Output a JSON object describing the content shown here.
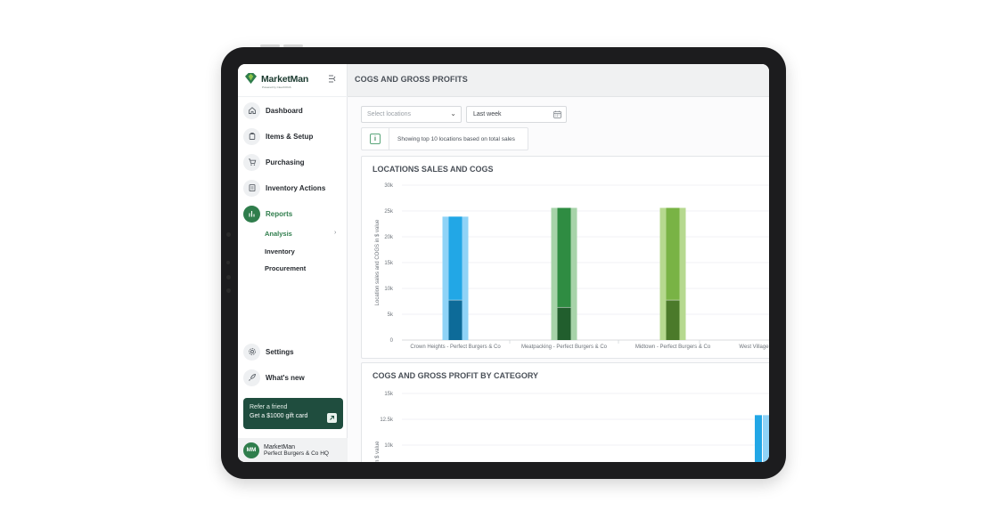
{
  "app": {
    "logo_text": "MarketMan",
    "logo_subtext": "Powered by ClearCOGS",
    "page_title": "COGS AND GROSS PROFITS"
  },
  "sidebar": {
    "collapse_icon": "collapse-icon",
    "items": [
      {
        "label": "Dashboard",
        "icon": "home-icon"
      },
      {
        "label": "Items & Setup",
        "icon": "items-icon"
      },
      {
        "label": "Purchasing",
        "icon": "cart-icon"
      },
      {
        "label": "Inventory Actions",
        "icon": "inventory-icon"
      },
      {
        "label": "Reports",
        "icon": "reports-icon",
        "active": true
      }
    ],
    "sub_items": [
      {
        "label": "Analysis",
        "active": true
      },
      {
        "label": "Inventory"
      },
      {
        "label": "Procurement"
      }
    ],
    "bottom_items": [
      {
        "label": "Settings",
        "icon": "gear-icon"
      },
      {
        "label": "What's new",
        "icon": "rocket-icon"
      }
    ],
    "refer": {
      "line1": "Refer a friend",
      "line2": "Get a $1000 gift card"
    },
    "user": {
      "initials": "MM",
      "name": "MarketMan",
      "org": "Perfect Burgers & Co HQ"
    }
  },
  "filters": {
    "location_placeholder": "Select locations",
    "date_value": "Last week",
    "info_text": "Showing top 10 locations based on total sales",
    "info_icon": "i"
  },
  "colors": {
    "brand_green": "#2f7d4c",
    "refer_bg": "#1f4d3e"
  },
  "chart_data": [
    {
      "type": "bar",
      "title": "LOCATIONS SALES AND COGS",
      "ylabel": "Location sales and COGS in $ value",
      "ylim": [
        0,
        30000
      ],
      "yticks": [
        "0",
        "5k",
        "10k",
        "15k",
        "20k",
        "25k",
        "30k"
      ],
      "categories": [
        "Crown Heights - Perfect Burgers & Co",
        "Meatpacking - Perfect Burgers & Co",
        "Midtown - Perfect Burgers & Co",
        "West Village"
      ],
      "series": [
        {
          "values": [
            23900,
            25600,
            25600,
            null
          ],
          "colors": [
            "#8fd3f7",
            "#a7d3a9",
            "#b6d98f"
          ]
        },
        {
          "values": [
            23900,
            25600,
            25600,
            null
          ],
          "colors": [
            "#22a7e6",
            "#2f8c42",
            "#79b345"
          ]
        },
        {
          "values": [
            7700,
            6300,
            7700,
            null
          ],
          "colors": [
            "#0d6b99",
            "#215e2d",
            "#4b7a2a"
          ]
        }
      ]
    },
    {
      "type": "bar",
      "title": "COGS AND GROSS PROFIT BY CATEGORY",
      "ylabel": "COGS in $ value",
      "ylim": [
        0,
        15000
      ],
      "yticks": [
        "10k",
        "12.5k",
        "15k"
      ],
      "series": [
        {
          "values": [
            12900
          ],
          "colors": [
            "#22a7e6"
          ]
        },
        {
          "values": [
            12900
          ],
          "colors": [
            "#8fd3f7"
          ]
        }
      ]
    }
  ]
}
